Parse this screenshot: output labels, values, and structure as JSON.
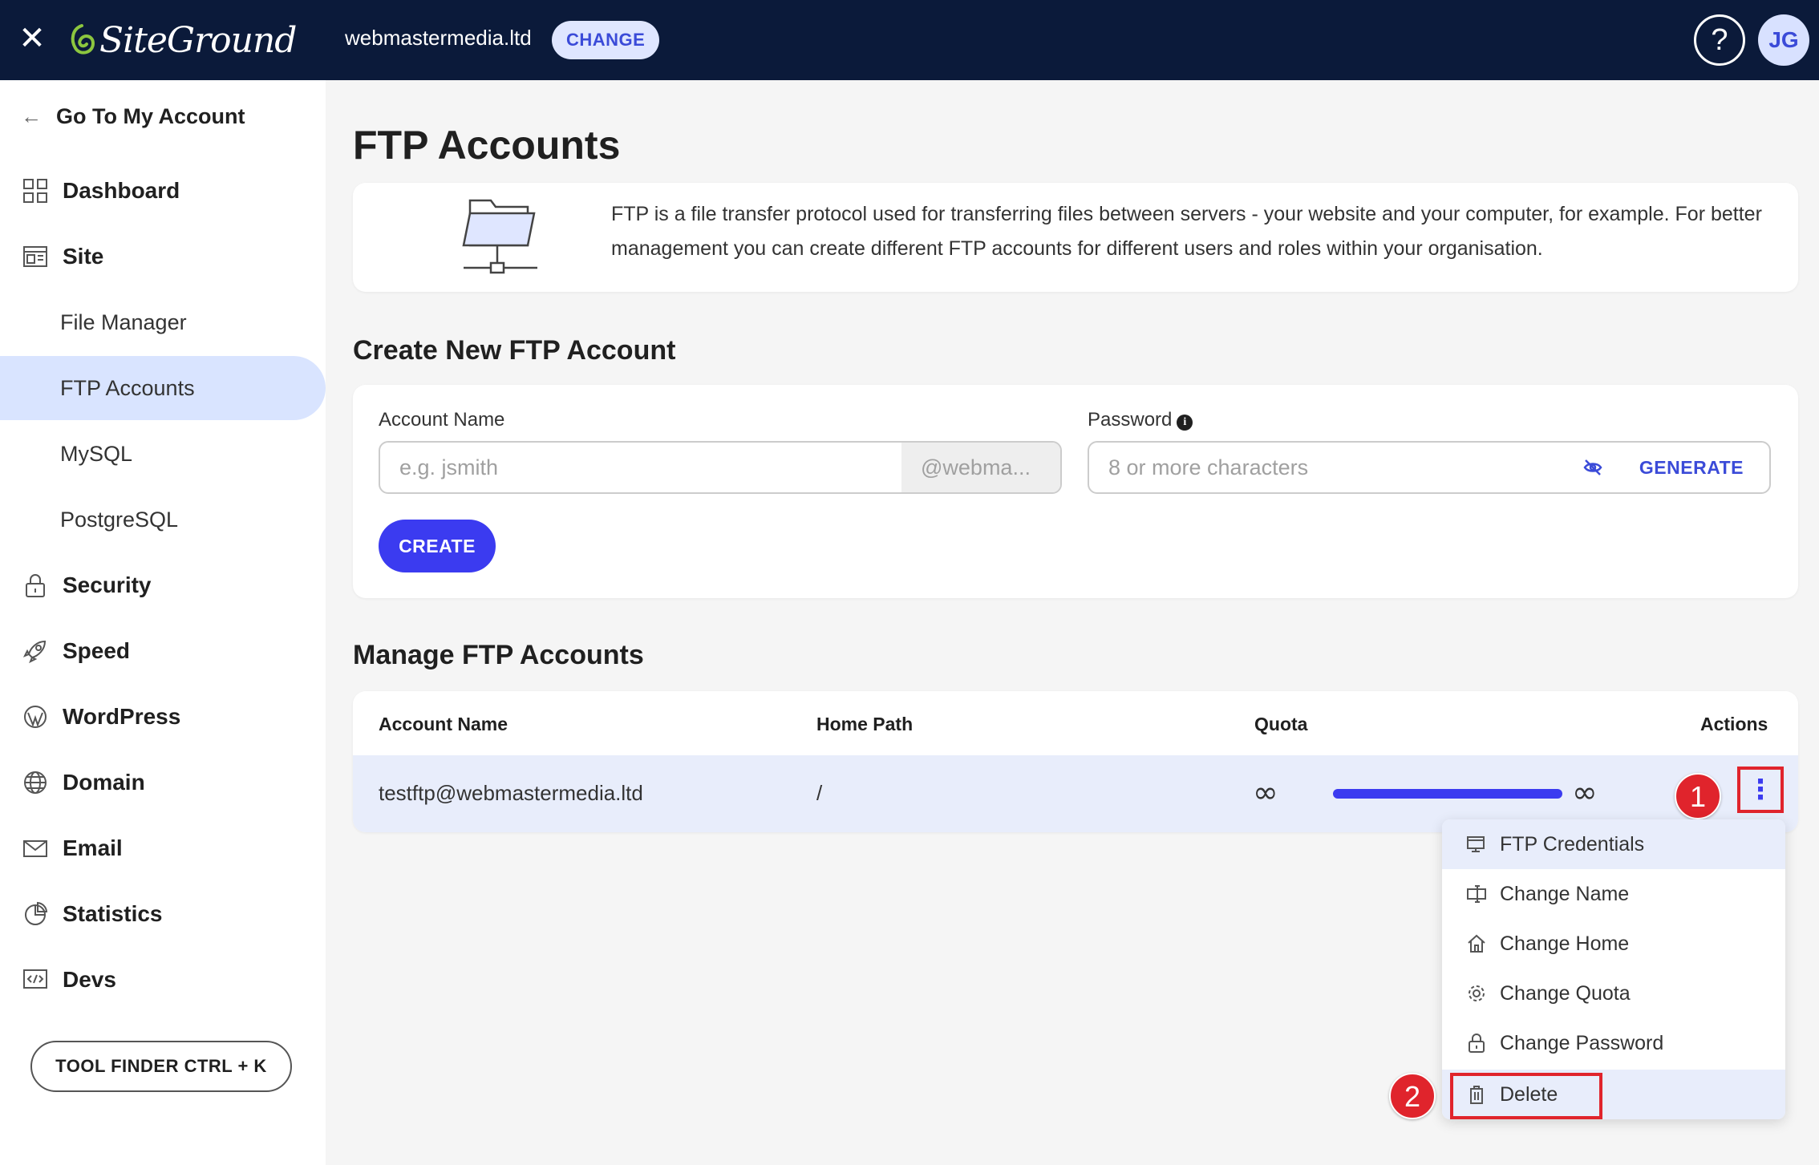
{
  "topbar": {
    "close_glyph": "✕",
    "brand": "SiteGround",
    "domain": "webmastermedia.ltd",
    "change_label": "CHANGE",
    "help_glyph": "?",
    "avatar_initials": "JG"
  },
  "sidebar": {
    "back_label": "Go To My Account",
    "items": [
      {
        "label": "Dashboard",
        "icon": "dashboard-icon"
      },
      {
        "label": "Site",
        "icon": "site-icon"
      },
      {
        "label": "Security",
        "icon": "lock-icon"
      },
      {
        "label": "Speed",
        "icon": "rocket-icon"
      },
      {
        "label": "WordPress",
        "icon": "wordpress-icon"
      },
      {
        "label": "Domain",
        "icon": "globe-icon"
      },
      {
        "label": "Email",
        "icon": "envelope-icon"
      },
      {
        "label": "Statistics",
        "icon": "pie-chart-icon"
      },
      {
        "label": "Devs",
        "icon": "code-icon"
      }
    ],
    "site_sub": [
      "File Manager",
      "FTP Accounts",
      "MySQL",
      "PostgreSQL"
    ],
    "active_sub": "FTP Accounts",
    "tool_finder_label": "TOOL FINDER CTRL + K"
  },
  "main": {
    "title": "FTP Accounts",
    "info_text": "FTP is a file transfer protocol used for transferring files between servers - your website and your computer, for example. For better management you can create different FTP accounts for different users and roles within your organisation.",
    "create": {
      "title": "Create New FTP Account",
      "account_label": "Account Name",
      "account_placeholder": "e.g. jsmith",
      "account_suffix": "@webma...",
      "password_label": "Password",
      "password_info_glyph": "i",
      "password_placeholder": "8 or more characters",
      "generate_label": "GENERATE",
      "create_label": "CREATE"
    },
    "manage": {
      "title": "Manage FTP Accounts",
      "columns": [
        "Account Name",
        "Home Path",
        "Quota",
        "Actions"
      ],
      "rows": [
        {
          "account": "testftp@webmastermedia.ltd",
          "home": "/",
          "quota_used": "∞",
          "quota_total": "∞",
          "quota_fill": 1.0
        }
      ],
      "kebab_glyph": "⋮"
    },
    "menu": {
      "items": [
        {
          "label": "FTP Credentials",
          "icon": "monitor-icon"
        },
        {
          "label": "Change Name",
          "icon": "rename-icon"
        },
        {
          "label": "Change Home",
          "icon": "home-icon"
        },
        {
          "label": "Change Quota",
          "icon": "gear-icon"
        },
        {
          "label": "Change Password",
          "icon": "lock-icon"
        },
        {
          "label": "Delete",
          "icon": "trash-icon"
        }
      ]
    },
    "annotations": [
      "1",
      "2"
    ]
  },
  "colors": {
    "topbar": "#0b1a3a",
    "accent": "#3b3bf0",
    "active_bg": "#d9e4ff",
    "annotation_red": "#e0242c",
    "logo_green": "#8cc63f"
  }
}
